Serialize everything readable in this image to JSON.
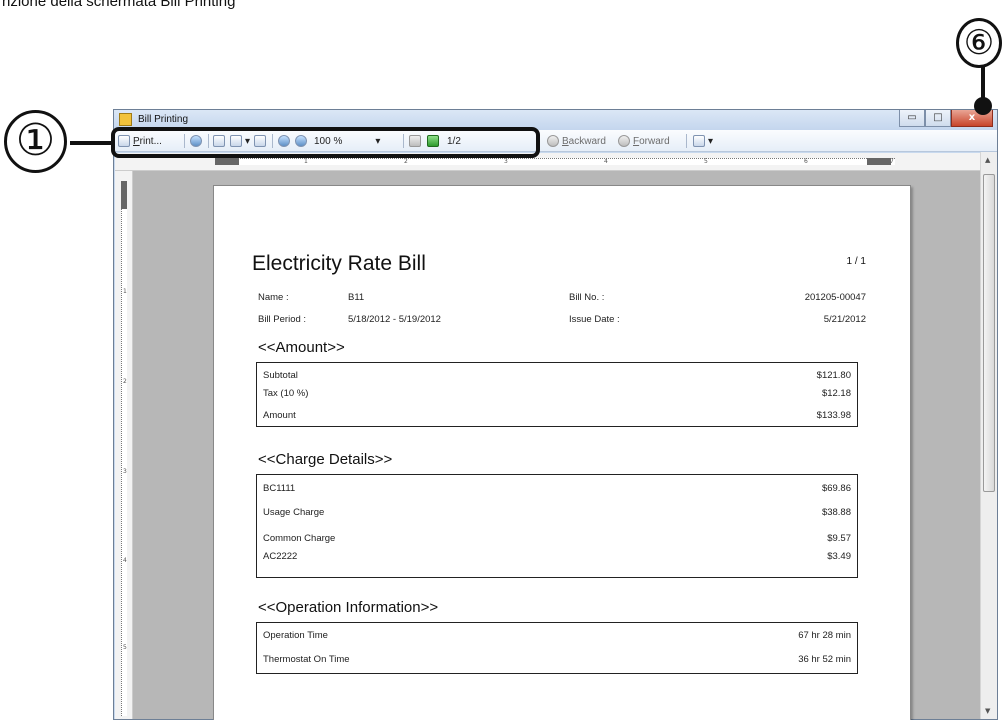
{
  "caption": "nzione della schermata Bill Printing",
  "callouts": {
    "left": "①",
    "top": "⑥"
  },
  "window": {
    "title": "Bill Printing",
    "buttons": {
      "minimize": "▭",
      "maximize": "□",
      "close": "x"
    }
  },
  "toolbar": {
    "print": "Print...",
    "zoom": "100 %",
    "zoom_arrow": "▾",
    "page": "1/2",
    "backward": "Backward",
    "forward": "Forward"
  },
  "ruler": {
    "h": [
      "1",
      "2",
      "3",
      "4",
      "5",
      "6",
      "7"
    ],
    "v": [
      "1",
      "2",
      "3",
      "4",
      "5"
    ]
  },
  "bill": {
    "title": "Electricity Rate Bill",
    "page_count": "1  /    1",
    "name_label": "Name :",
    "name_value": "B11",
    "bill_no_label": "Bill No. :",
    "bill_no_value": "201205-00047",
    "period_label": "Bill Period :",
    "period_value": "5/18/2012 - 5/19/2012",
    "issue_label": "Issue Date :",
    "issue_value": "5/21/2012",
    "amount_section": "<<Amount>>",
    "amount_rows": [
      {
        "label": "Subtotal",
        "value": "$121.80"
      },
      {
        "label": "Tax (10 %)",
        "value": "$12.18"
      },
      {
        "label": "Amount",
        "value": "$133.98"
      }
    ],
    "charge_section": "<<Charge Details>>",
    "charge_rows": [
      {
        "label": "BC1111",
        "value": "$69.86"
      },
      {
        "label": "Usage Charge",
        "value": "$38.88"
      },
      {
        "label": "Common Charge",
        "value": "$9.57"
      },
      {
        "label": "AC2222",
        "value": "$3.49"
      }
    ],
    "operation_section": "<<Operation Information>>",
    "operation_rows": [
      {
        "label": "Operation Time",
        "value": "67 hr 28 min"
      },
      {
        "label": "Thermostat On Time",
        "value": "36 hr 52 min"
      }
    ]
  },
  "scrollbar": {
    "up": "▲",
    "down": "▼"
  }
}
